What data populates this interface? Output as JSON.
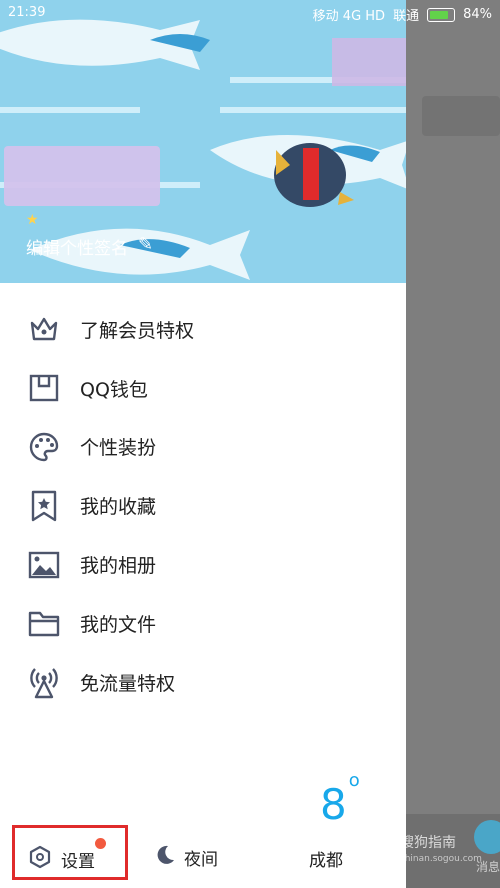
{
  "status_bar": {
    "time": "21:39",
    "carrier_1": "移动 4G HD",
    "carrier_2": "联通",
    "battery": "84%"
  },
  "profile": {
    "signature": "编辑个性签名"
  },
  "menu": {
    "items": [
      {
        "label": "了解会员特权",
        "icon": "crown-icon"
      },
      {
        "label": "QQ钱包",
        "icon": "wallet-icon"
      },
      {
        "label": "个性装扮",
        "icon": "palette-icon"
      },
      {
        "label": "我的收藏",
        "icon": "favorite-icon"
      },
      {
        "label": "我的相册",
        "icon": "photo-icon"
      },
      {
        "label": "我的文件",
        "icon": "folder-icon"
      },
      {
        "label": "免流量特权",
        "icon": "signal-tower-icon"
      }
    ]
  },
  "footer": {
    "settings_label": "设置",
    "night_label": "夜间",
    "temperature": "8",
    "temperature_unit": "o",
    "city": "成都"
  },
  "background_app": {
    "watermark": "搜狗指南",
    "watermark_url": "zhinan.sogou.com",
    "messages_label": "消息"
  },
  "colors": {
    "accent": "#18a8ea",
    "header_bg": "#8fd2ec",
    "highlight_box": "#e02b2b",
    "notification_dot": "#f25a3f"
  }
}
